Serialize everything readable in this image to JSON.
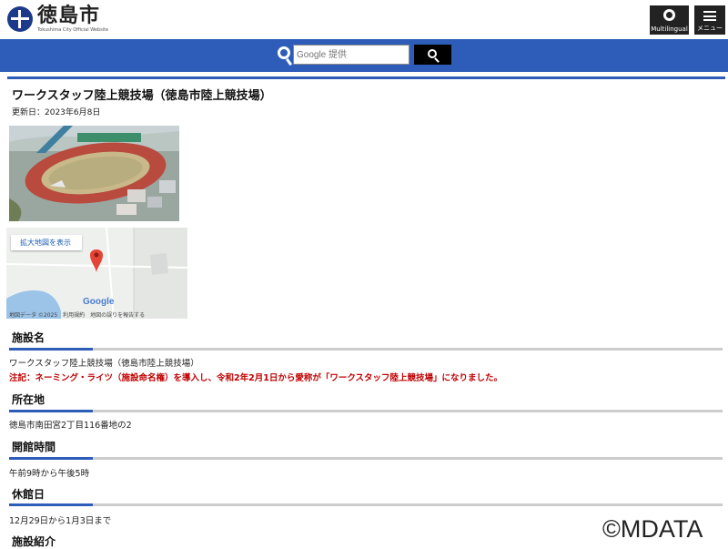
{
  "header": {
    "logo_title": "徳島市",
    "logo_subtitle": "Tokushima City Official Website",
    "multilingual_label": "Multilingual",
    "menu_label": "メニュー"
  },
  "search": {
    "placeholder": "Google 提供",
    "button_icon": "search-icon"
  },
  "page": {
    "title": "ワークスタッフ陸上競技場（徳島市陸上競技場）",
    "updated": "更新日：2023年6月8日"
  },
  "map": {
    "link_label": "拡大地図を表示",
    "brand": "Google",
    "footer": "地図データ ©2025　利用規約　地図の誤りを報告する"
  },
  "sections": [
    {
      "heading": "施設名",
      "text": "ワークスタッフ陸上競技場（徳島市陸上競技場）"
    },
    {
      "heading": "所在地",
      "text": "徳島市南田宮2丁目116番地の2"
    },
    {
      "heading": "開館時間",
      "text": "午前9時から午後5時"
    },
    {
      "heading": "休館日",
      "text": "12月29日から1月3日まで"
    },
    {
      "heading": "施設紹介",
      "text": ""
    }
  ],
  "note": "注記：ネーミング・ライツ（施設命名権）を導入し、令和2年2月1日から愛称が「ワークスタッフ陸上競技場」になりました。",
  "watermark": "©MDATA",
  "colors": {
    "accent": "#2d5db8",
    "note": "#c00000",
    "header_button": "#222222"
  }
}
